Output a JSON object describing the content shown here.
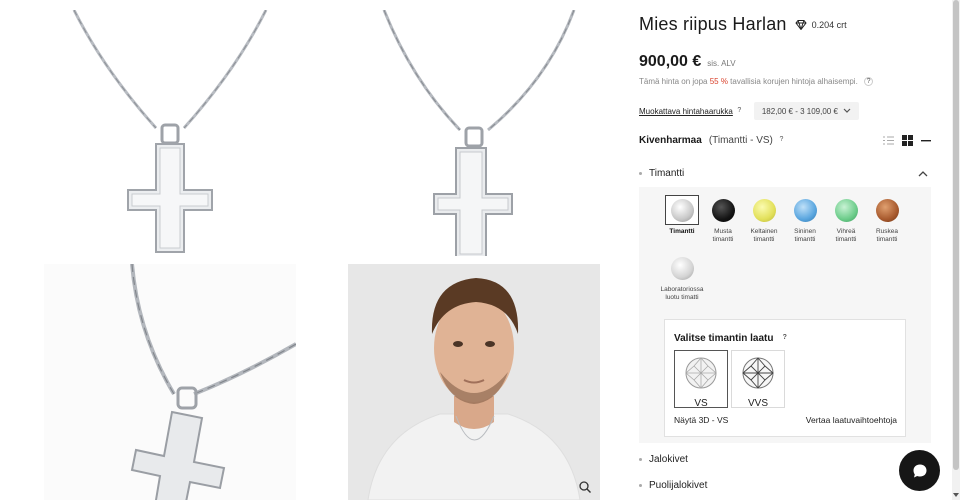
{
  "product": {
    "title": "Mies riipus Harlan",
    "carat": "0.204 crt",
    "price": "900,00 €",
    "vat": "sis. ALV",
    "note_before": "Tämä hinta on jopa ",
    "note_pct": "55 %",
    "note_after": " tavallisia korujen hintoja alhaisempi.",
    "help_mark": "?"
  },
  "price_range": {
    "link": "Muokattava hintahaarukka",
    "selected": "182,00 € - 3 109,00 €"
  },
  "gemstone": {
    "label": "Kivenharmaa",
    "value": "(Timantti - VS)"
  },
  "accordion": {
    "open_item": "Timantti",
    "items": [
      "Jalokivet",
      "Puolijalokivet"
    ]
  },
  "stones": [
    {
      "name": "Timantti",
      "color": "#dcdcdc",
      "selected": true
    },
    {
      "name": "Musta timantti",
      "color": "#151515",
      "selected": false
    },
    {
      "name": "Keltainen timantti",
      "color": "#e2e05a",
      "selected": false
    },
    {
      "name": "Sininen timantti",
      "color": "#5aa6df",
      "selected": false
    },
    {
      "name": "Vihreä timantti",
      "color": "#6ccc8a",
      "selected": false
    },
    {
      "name": "Ruskea timantti",
      "color": "#a85a2e",
      "selected": false
    },
    {
      "name": "Laboratoriossa luotu timatti",
      "color": "#e2e2e2",
      "selected": false
    }
  ],
  "quality": {
    "title": "Valitse timantin laatu",
    "options": [
      {
        "label": "VS",
        "selected": true
      },
      {
        "label": "VVS",
        "selected": false
      }
    ],
    "show3d": "Näytä 3D - VS",
    "compare": "Vertaa laatuvaihtoehtoja"
  },
  "colors": {
    "accent_pct": "#d9412b",
    "chat_button": "#161616"
  },
  "icons": [
    "diamond-icon",
    "list-view-icon",
    "grid-view-icon",
    "collapse-icon",
    "chevron-up-icon",
    "chevron-down-icon",
    "zoom-icon",
    "chat-icon"
  ]
}
